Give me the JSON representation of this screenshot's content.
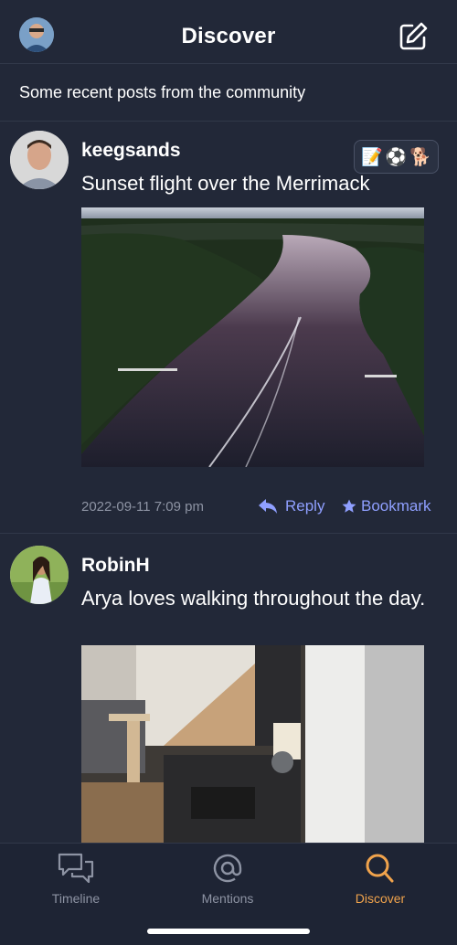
{
  "header": {
    "title": "Discover",
    "avatar_icon": "user-avatar",
    "compose_icon": "compose-icon"
  },
  "subbar": {
    "caption": "Some recent posts from the community",
    "emojis": [
      "📝",
      "⚽",
      "🐕"
    ]
  },
  "posts": [
    {
      "username": "keegsands",
      "text": "Sunset flight over the Merrimack",
      "date": "2022-09-11 7:09 pm",
      "reply_label": "Reply",
      "bookmark_label": "Bookmark",
      "photo_description_icon": "aerial-river-photo"
    },
    {
      "username": "RobinH",
      "text": "Arya loves walking throughout the day.",
      "photo_description_icon": "living-room-photo"
    }
  ],
  "tabs": [
    {
      "label": "Timeline",
      "icon": "chat-bubbles-icon",
      "active": false
    },
    {
      "label": "Mentions",
      "icon": "at-icon",
      "active": false
    },
    {
      "label": "Discover",
      "icon": "search-icon",
      "active": true
    }
  ],
  "colors": {
    "background": "#222838",
    "accent_link": "#8f9fff",
    "active_tab": "#f0a34c",
    "muted": "#8d93a3"
  }
}
